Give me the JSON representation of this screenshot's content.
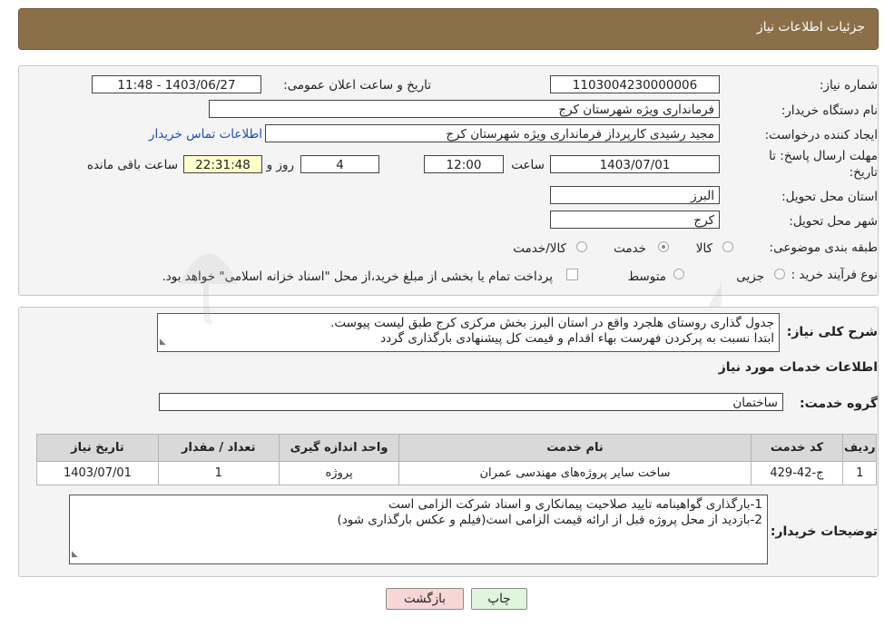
{
  "header": {
    "title": "جزئیات اطلاعات نیاز"
  },
  "info": {
    "need_number_label": "شماره نیاز:",
    "need_number": "1103004230000006",
    "announce_label": "تاریخ و ساعت اعلان عمومی:",
    "announce_value": "1403/06/27 - 11:48",
    "buyer_org_label": "نام دستگاه خریدار:",
    "buyer_org": "فرمانداری ویژه شهرستان کرج",
    "creator_label": "ایجاد کننده درخواست:",
    "creator": "مجید رشیدی کارپرداز فرمانداری ویژه شهرستان کرج",
    "contact_link": "اطلاعات تماس خریدار",
    "deadline_label_1": "مهلت ارسال پاسخ: تا",
    "deadline_label_2": "تاریخ:",
    "deadline_date": "1403/07/01",
    "time_label": "ساعت",
    "deadline_time": "12:00",
    "days_value": "4",
    "days_label": "روز و",
    "remaining_time": "22:31:48",
    "remaining_label": "ساعت باقی مانده",
    "province_label": "استان محل تحویل:",
    "province": "البرز",
    "city_label": "شهر محل تحویل:",
    "city": "کرج",
    "category_label": "طبقه بندی موضوعی:",
    "category_options": [
      "کالا",
      "خدمت",
      "کالا/خدمت"
    ],
    "category_selected": "خدمت",
    "process_label": "نوع فرآیند خرید :",
    "process_options": [
      "جزیی",
      "متوسط"
    ],
    "payment_note": "پرداخت تمام یا بخشی از مبلغ خرید،از محل \"اسناد خزانه اسلامی\" خواهد بود."
  },
  "description": {
    "label": "شرح کلی نیاز:",
    "line1": "جدول گذاری روستای هلجرد واقع در استان البرز بخش مرکزی کرج طبق لیست پیوست.",
    "line2": "ابتدا نسبت به پرکردن فهرست بهاء اقدام و قیمت کل پیشنهادی بارگذاری گردد"
  },
  "services": {
    "section_title": "اطلاعات خدمات مورد نیاز",
    "group_label": "گروه خدمت:",
    "group_value": "ساختمان",
    "columns": [
      "ردیف",
      "کد خدمت",
      "نام خدمت",
      "واحد اندازه گیری",
      "تعداد / مقدار",
      "تاریخ نیاز"
    ],
    "rows": [
      [
        "1",
        "ج-42-429",
        "ساخت سایر پروژه‌های مهندسی عمران",
        "پروژه",
        "1",
        "1403/07/01"
      ]
    ]
  },
  "buyer_notes": {
    "label": "توضیحات خریدار:",
    "line1": "1-بارگذاری گواهینامه تایید صلاحیت پیمانکاری و اسناد شرکت الزامی است",
    "line2": "2-بازدید از محل پروژه قبل از ارائه قیمت الزامی است(فیلم و عکس بارگذاری شود)"
  },
  "actions": {
    "print": "چاپ",
    "back": "بازگشت"
  },
  "watermark": {
    "text": "AriaTender.neT"
  },
  "colors": {
    "header": "#8b6f48",
    "back_button": "#f8d6d6",
    "print_button": "#dff5dc",
    "link": "#1a4fb5"
  }
}
